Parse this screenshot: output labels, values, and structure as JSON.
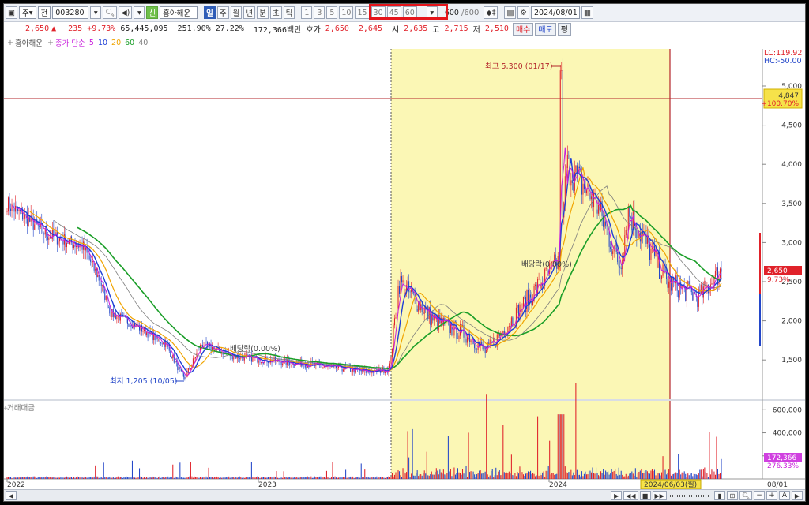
{
  "toolbar": {
    "market": "주",
    "type": "전",
    "code": "003280",
    "name": "흥아해운",
    "periods": [
      {
        "label": "일",
        "selected": true
      },
      {
        "label": "주",
        "selected": false
      },
      {
        "label": "월",
        "selected": false
      },
      {
        "label": "년",
        "selected": false
      },
      {
        "label": "분",
        "selected": false
      },
      {
        "label": "초",
        "selected": false
      },
      {
        "label": "틱",
        "selected": false
      }
    ],
    "intervals": [
      "1",
      "3",
      "5",
      "10",
      "15",
      "30",
      "45",
      "60"
    ],
    "count": "600",
    "count_total": "/600",
    "date": "2024/08/01"
  },
  "quote": {
    "price": "2,650",
    "change": "235",
    "change_pct": "+9.73%",
    "volume": "65,445,095",
    "turnover_pct": "251.90%",
    "ratio": "27.22%",
    "amount": "172,366백만",
    "bid_label": "호가",
    "ask": "2,650",
    "bid": "2,645",
    "open_label": "시",
    "open": "2,635",
    "high_label": "고",
    "high": "2,715",
    "low_label": "저",
    "low": "2,510",
    "buy": "매수",
    "sell": "매도",
    "flat": "평"
  },
  "legend": {
    "name": "흥아해운",
    "ma_prefix": "종가 단순",
    "ma": [
      {
        "label": "5",
        "color": "#c81edc"
      },
      {
        "label": "10",
        "color": "#1f3fd6"
      },
      {
        "label": "20",
        "color": "#f0a400"
      },
      {
        "label": "60",
        "color": "#1a9e28"
      },
      {
        "label": "40",
        "color": "#7d7d7d"
      }
    ],
    "volume_label": "거래대금"
  },
  "price_axis": {
    "lc": "LC:119.92",
    "hc": "HC:-50.00",
    "ticks": [
      "5,000",
      "4,500",
      "4,000",
      "3,500",
      "3,000",
      "2,500",
      "2,000",
      "1,500"
    ],
    "marker_price": "4,847",
    "marker_pct": "+100.70%",
    "current": "2,650",
    "current_pct": "9.73%"
  },
  "volume_axis": {
    "ticks": [
      "600,000",
      "400,000",
      "200,000"
    ],
    "current": "172,366",
    "current_pct": "276.33%"
  },
  "time_axis": {
    "labels": [
      "2022",
      "2023",
      "2024"
    ],
    "end": "08/01",
    "cursor": "2024/06/03(월)"
  },
  "annotations": {
    "high": "최고 5,300 (01/17)",
    "low": "최저 1,205 (10/05)",
    "dividend1": "배당락(0.00%)",
    "dividend2": "배당락(0.00%)"
  },
  "colors": {
    "up": "#e0222a",
    "down": "#2447c9",
    "highlight": "#fbf7b5",
    "ma5": "#c81edc",
    "ma10": "#1f3fd6",
    "ma20": "#f0a400",
    "ma60": "#1a9e28",
    "ma40": "#7d7d7d"
  },
  "chart_data": {
    "type": "line",
    "series": [
      {
        "name": "종가",
        "x": [
          "2022/01",
          "2022/03",
          "2022/05",
          "2022/06",
          "2022/07",
          "2022/08",
          "2022/09",
          "2022/10/05",
          "2022/11",
          "2022/12",
          "2023/01",
          "2023/03",
          "2023/05",
          "2023/07",
          "2023/08",
          "2023/09",
          "2023/10",
          "2023/11",
          "2023/12",
          "2024/01/17",
          "2024/02",
          "2024/03",
          "2024/04",
          "2024/05",
          "2024/06",
          "2024/07",
          "2024/08/01"
        ],
        "values": [
          3500,
          3100,
          2950,
          2500,
          2100,
          1950,
          1700,
          1250,
          1700,
          1550,
          1500,
          1450,
          1400,
          1350,
          1380,
          2500,
          2000,
          1800,
          1600,
          2800,
          4000,
          3500,
          2700,
          3400,
          2500,
          2300,
          2650
        ]
      }
    ],
    "ylim": [
      1000,
      5400
    ]
  }
}
